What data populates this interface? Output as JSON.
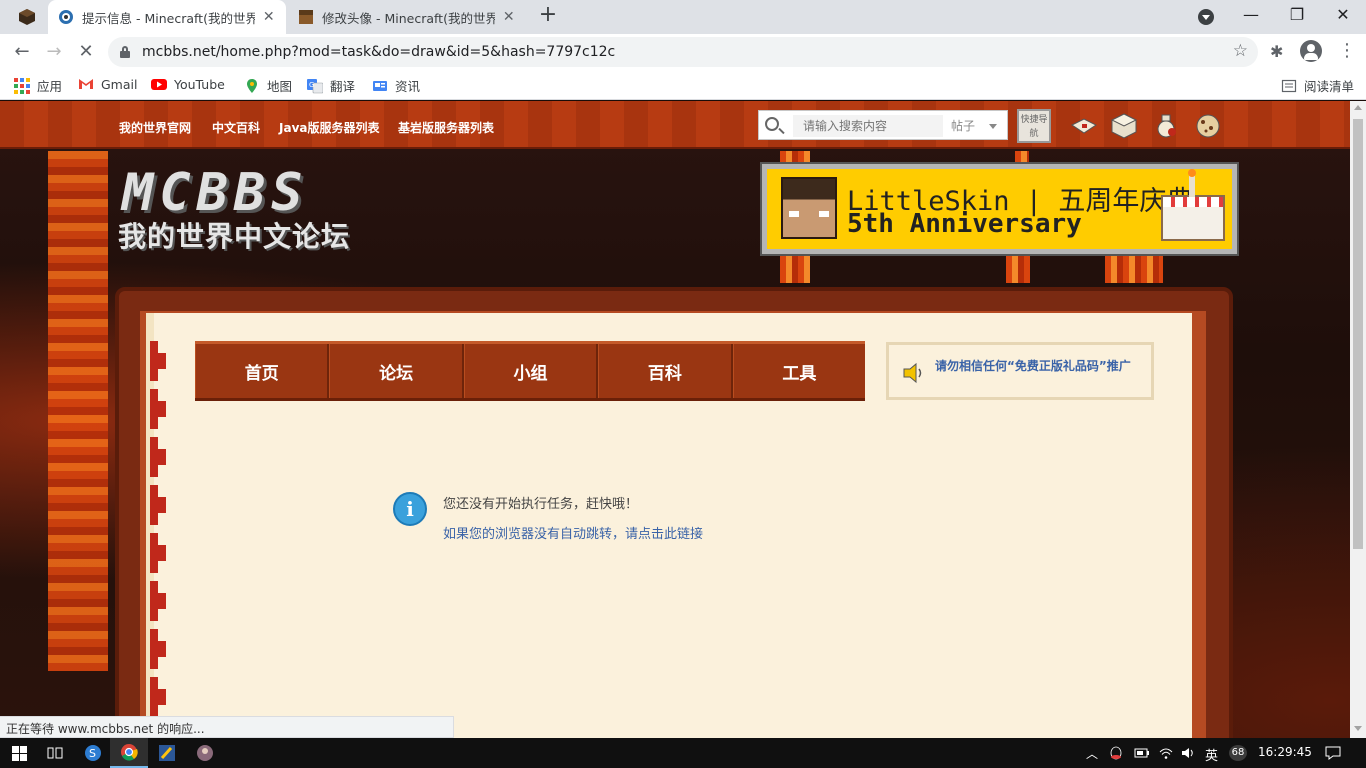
{
  "browser": {
    "tabs": [
      {
        "title": "提示信息 - Minecraft(我的世界)中",
        "active": true
      },
      {
        "title": "修改头像 - Minecraft(我的世界)中",
        "active": false
      }
    ],
    "newtab": "+",
    "window_controls": {
      "minimize": "—",
      "maximize": "❐",
      "close": "✕"
    },
    "url": "mcbbs.net/home.php?mod=task&do=draw&id=5&hash=7797c12c",
    "nav": {
      "back": "←",
      "forward": "→",
      "reload": "✕"
    },
    "star": "☆",
    "extensions": "✱",
    "menu": "⋮"
  },
  "bookmarks": {
    "apps": "应用",
    "items": [
      {
        "label": "Gmail",
        "icon": "gmail-icon"
      },
      {
        "label": "YouTube",
        "icon": "youtube-icon"
      },
      {
        "label": "地图",
        "icon": "maps-icon"
      },
      {
        "label": "翻译",
        "icon": "translate-icon"
      },
      {
        "label": "资讯",
        "icon": "news-icon"
      }
    ],
    "reading_list": "阅读清单"
  },
  "site": {
    "topnav": [
      "我的世界官网",
      "中文百科",
      "Java版服务器列表",
      "基岩版服务器列表"
    ],
    "search": {
      "placeholder": "请输入搜索内容",
      "type": "帖子",
      "advanced": "快捷导航"
    },
    "logo": {
      "line1": "MCBBS",
      "line2": "我的世界中文论坛"
    },
    "banner": {
      "line1": "LittleSkin | 五周年庆典",
      "line2": "5th Anniversary"
    },
    "mainnav": [
      "首页",
      "论坛",
      "小组",
      "百科",
      "工具"
    ],
    "notice": "请勿相信任何“免费正版礼品码”推广",
    "message": {
      "icon": "i",
      "text": "您还没有开始执行任务，赶快哦！",
      "link": "如果您的浏览器没有自动跳转，请点击此链接"
    }
  },
  "statusbar": "正在等待 www.mcbbs.net 的响应...",
  "taskbar": {
    "tray": {
      "ime": "英",
      "badge": "68",
      "time": "16:29:45"
    }
  },
  "colors": {
    "header_bar": "#b73b12",
    "nav_bg": "#9a3612",
    "paper": "#fbf1dc",
    "link": "#3a63a8",
    "banner_bg": "#ffcc00",
    "info_icon": "#3aa1dc"
  }
}
